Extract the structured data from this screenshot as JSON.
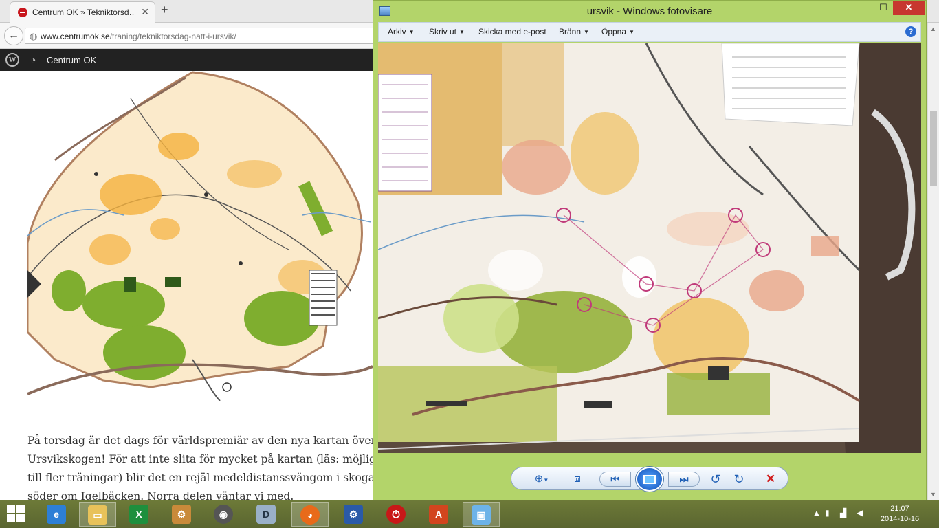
{
  "browser": {
    "tab_title": "Centrum OK » Tekniktorsd…",
    "tab_close": "✕",
    "new_tab": "+",
    "back": "←",
    "url_domain": "www.centrumok.se",
    "url_path": "/traning/tekniktorsdag-natt-i-ursvik/",
    "wp_site_name": "Centrum OK"
  },
  "article": {
    "lines": [
      "På torsdag är det dags för världspremiär av den nya kartan över",
      "Ursvikskogen! För att inte slita för mycket på kartan (läs: möjlig",
      "till fler träningar) blir det en rejäl medeldistanssvängom i skoga",
      "söder om Igelbäcken. Norra delen väntar vi med."
    ]
  },
  "viewer": {
    "title": "ursvik - Windows fotovisare",
    "min": "—",
    "max": "☐",
    "close": "✕",
    "menu": [
      {
        "label": "Arkiv"
      },
      {
        "label": "Skriv ut"
      },
      {
        "label": "Skicka med e-post"
      },
      {
        "label": "Bränn"
      },
      {
        "label": "Öppna"
      }
    ],
    "help": "?"
  },
  "taskbar": {
    "time": "21:07",
    "date": "2014-10-16"
  },
  "colors": {
    "viewer_chrome": "#b3d46a",
    "taskbar": "#6d7a38",
    "wp_bar": "#222222",
    "map_forest_green": "#7fae2f",
    "map_open_yellow": "#f5b13d"
  }
}
